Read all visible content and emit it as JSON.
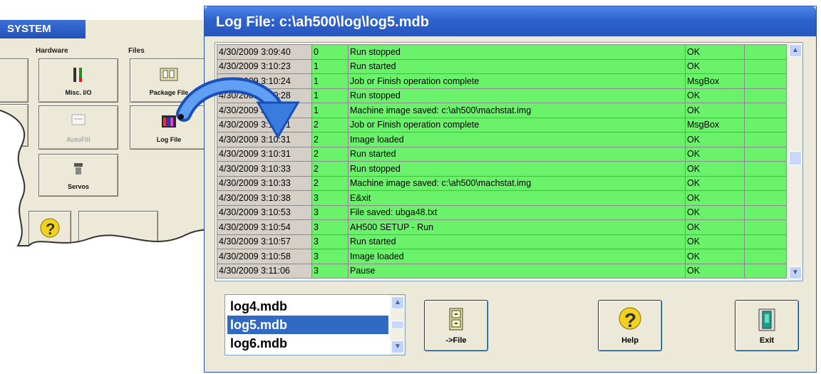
{
  "background_window": {
    "title": "SYSTEM",
    "groups": {
      "hardware": "Hardware",
      "files": "Files"
    },
    "buttons": [
      {
        "label": "Misc. I/O",
        "icon": "misc-io-icon",
        "enabled": true
      },
      {
        "label": "Package File",
        "icon": "package-file-icon",
        "enabled": true
      },
      {
        "label": "AutoFill",
        "icon": "autofill-icon",
        "enabled": false
      },
      {
        "label": "Log File",
        "icon": "log-file-icon",
        "enabled": true
      },
      {
        "label": "Servos",
        "icon": "servos-icon",
        "enabled": true
      },
      {
        "label": "",
        "icon": "help-icon",
        "enabled": true
      }
    ]
  },
  "log_window": {
    "title": "Log File: c:\\ah500\\log\\log5.mdb",
    "rows": [
      {
        "date": "4/30/2009 3:09:40",
        "num": "0",
        "message": "Run stopped",
        "result": "OK"
      },
      {
        "date": "4/30/2009 3:10:23",
        "num": "1",
        "message": "Run started",
        "result": "OK"
      },
      {
        "date": "4/30/2009 3:10:24",
        "num": "1",
        "message": "Job or Finish operation complete",
        "result": "MsgBox"
      },
      {
        "date": "4/30/2009 3:10:28",
        "num": "1",
        "message": "Run stopped",
        "result": "OK"
      },
      {
        "date": "4/30/2009 3:10:28",
        "num": "1",
        "message": "Machine image saved: c:\\ah500\\machstat.img",
        "result": "OK"
      },
      {
        "date": "4/30/2009 3:10:31",
        "num": "2",
        "message": "Job or Finish operation complete",
        "result": "MsgBox"
      },
      {
        "date": "4/30/2009 3:10:31",
        "num": "2",
        "message": "Image loaded",
        "result": "OK"
      },
      {
        "date": "4/30/2009 3:10:31",
        "num": "2",
        "message": "Run started",
        "result": "OK"
      },
      {
        "date": "4/30/2009 3:10:33",
        "num": "2",
        "message": "Run stopped",
        "result": "OK"
      },
      {
        "date": "4/30/2009 3:10:33",
        "num": "2",
        "message": "Machine image saved: c:\\ah500\\machstat.img",
        "result": "OK"
      },
      {
        "date": "4/30/2009 3:10:38",
        "num": "3",
        "message": "E&xit",
        "result": "OK"
      },
      {
        "date": "4/30/2009 3:10:53",
        "num": "3",
        "message": "File saved: ubga48.txt",
        "result": "OK"
      },
      {
        "date": "4/30/2009 3:10:54",
        "num": "3",
        "message": "AH500  SETUP  - Run",
        "result": "OK"
      },
      {
        "date": "4/30/2009 3:10:57",
        "num": "3",
        "message": "Run started",
        "result": "OK"
      },
      {
        "date": "4/30/2009 3:10:58",
        "num": "3",
        "message": "Image loaded",
        "result": "OK"
      },
      {
        "date": "4/30/2009 3:11:06",
        "num": "3",
        "message": "Pause",
        "result": "OK"
      }
    ],
    "files": [
      "log4.mdb",
      "log5.mdb",
      "log6.mdb"
    ],
    "selected_file": "log5.mdb",
    "buttons": {
      "to_file": "->File",
      "help": "Help",
      "exit": "Exit"
    },
    "colors": {
      "row_green": "#6bf26b",
      "date_cell": "#d4d0c8",
      "title_blue": "#2f62cf",
      "selection": "#316ac5"
    }
  }
}
